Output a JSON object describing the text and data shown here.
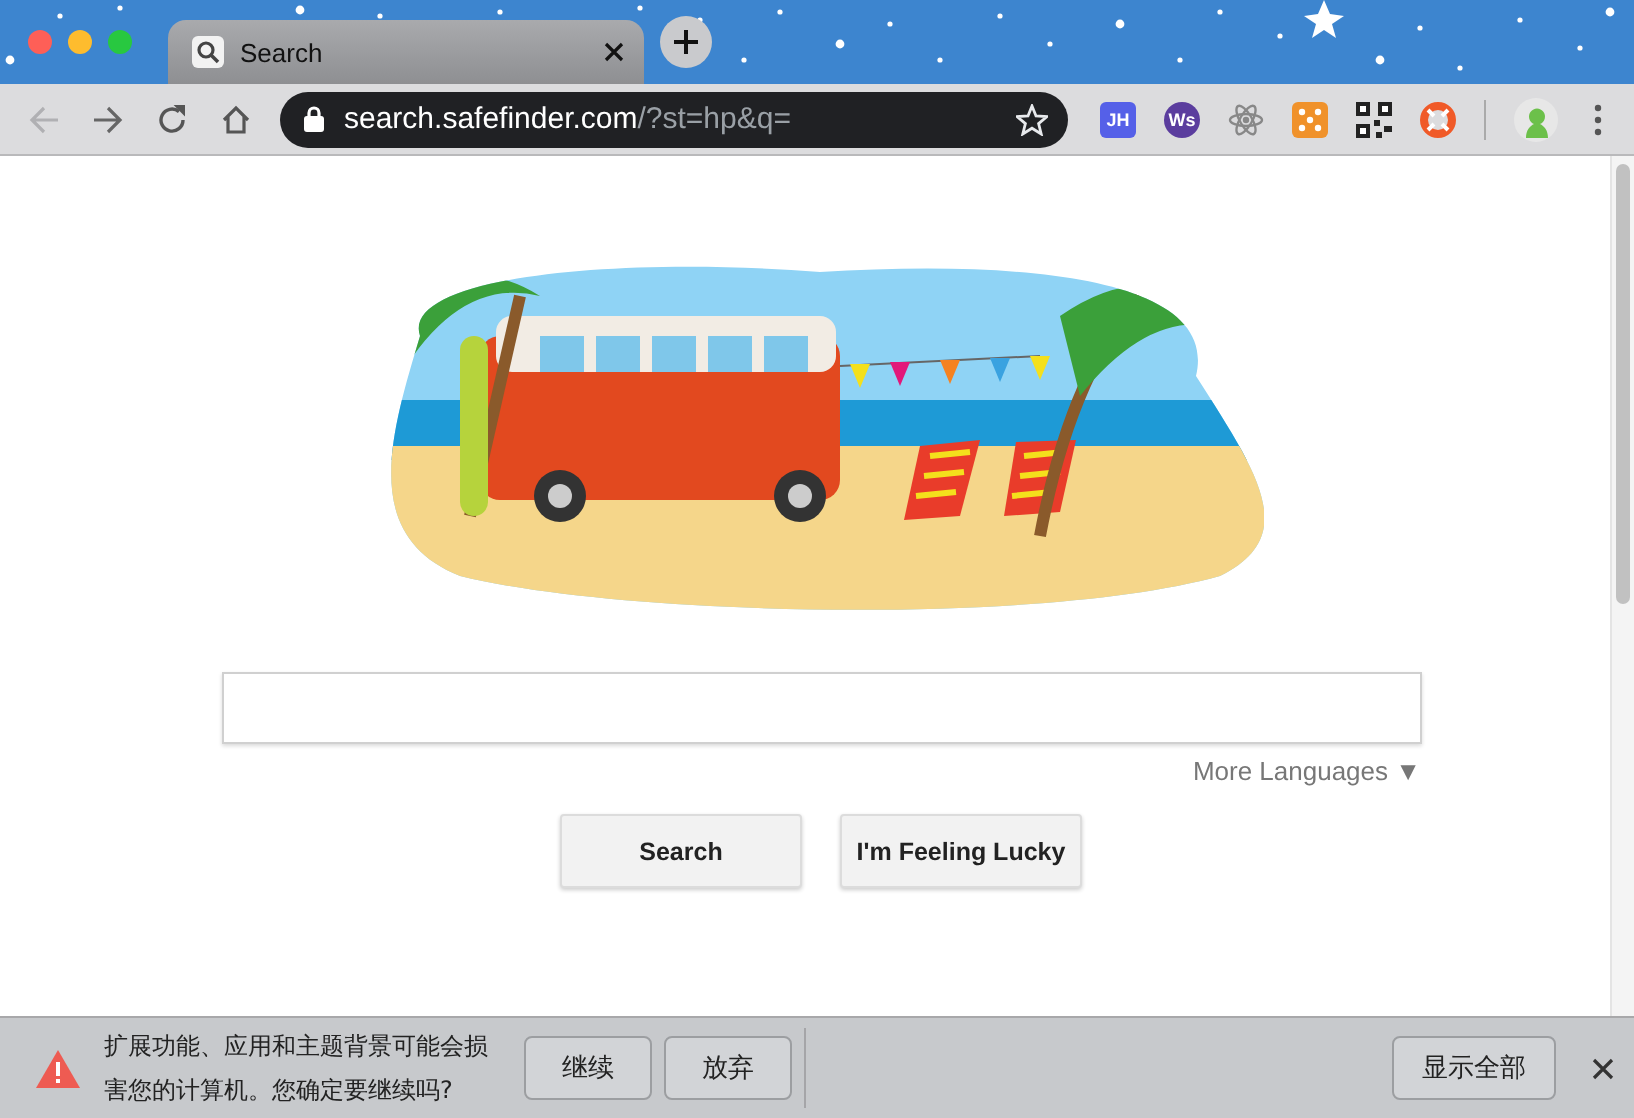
{
  "tab": {
    "title": "Search",
    "selected": true
  },
  "address_bar": {
    "host": "search.safefinder.com",
    "path": "/?st=hp&q="
  },
  "navigation": {
    "back_disabled": true,
    "forward_disabled": false
  },
  "extensions": [
    {
      "kind": "text",
      "label": "JH",
      "color": "#5560e8"
    },
    {
      "kind": "text",
      "label": "Ws",
      "color": "#5b3d9e"
    },
    {
      "kind": "atom"
    },
    {
      "kind": "dice"
    },
    {
      "kind": "qr"
    },
    {
      "kind": "lifebuoy"
    }
  ],
  "search_page": {
    "more_languages": "More Languages ▼",
    "buttons": [
      "Search",
      "I'm Feeling Lucky"
    ]
  },
  "info_bar": {
    "message": "扩展功能、应用和主题背景可能会损害您的计算机。您确定要继续吗?",
    "buttons": [
      "继续",
      "放弃"
    ],
    "show_all": "显示全部"
  }
}
